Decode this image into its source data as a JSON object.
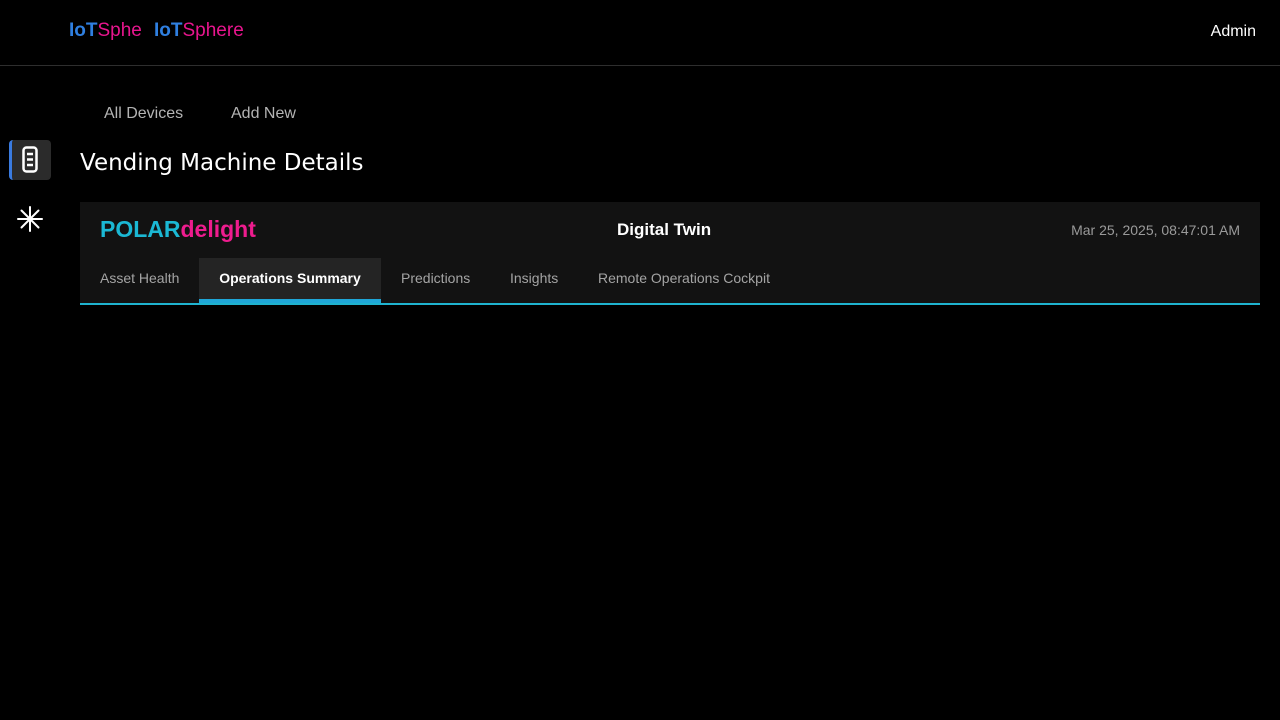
{
  "header": {
    "logo_primary": {
      "part1": "IoT",
      "part2": "Sphe"
    },
    "logo_secondary": {
      "part1": "IoT",
      "part2": "Sphere"
    },
    "user_label": "Admin"
  },
  "subnav": {
    "items": [
      {
        "label": "All Devices"
      },
      {
        "label": "Add New"
      }
    ]
  },
  "sidebar": {
    "items": [
      {
        "icon": "vending-machine-icon",
        "active": true
      },
      {
        "icon": "asterisk-icon",
        "active": false
      }
    ]
  },
  "page": {
    "title": "Vending Machine Details"
  },
  "card": {
    "brand": {
      "part1": "POLAR",
      "part2": "delight"
    },
    "title": "Digital Twin",
    "timestamp": "Mar 25, 2025, 08:47:01 AM",
    "tabs": [
      {
        "label": "Asset Health",
        "active": false
      },
      {
        "label": "Operations Summary",
        "active": true
      },
      {
        "label": "Predictions",
        "active": false
      },
      {
        "label": "Insights",
        "active": false
      },
      {
        "label": "Remote Operations Cockpit",
        "active": false
      }
    ]
  },
  "colors": {
    "accent_blue": "#2f7fe0",
    "accent_pink": "#e8158e",
    "accent_cyan": "#1bb8d4",
    "background": "#000000"
  }
}
